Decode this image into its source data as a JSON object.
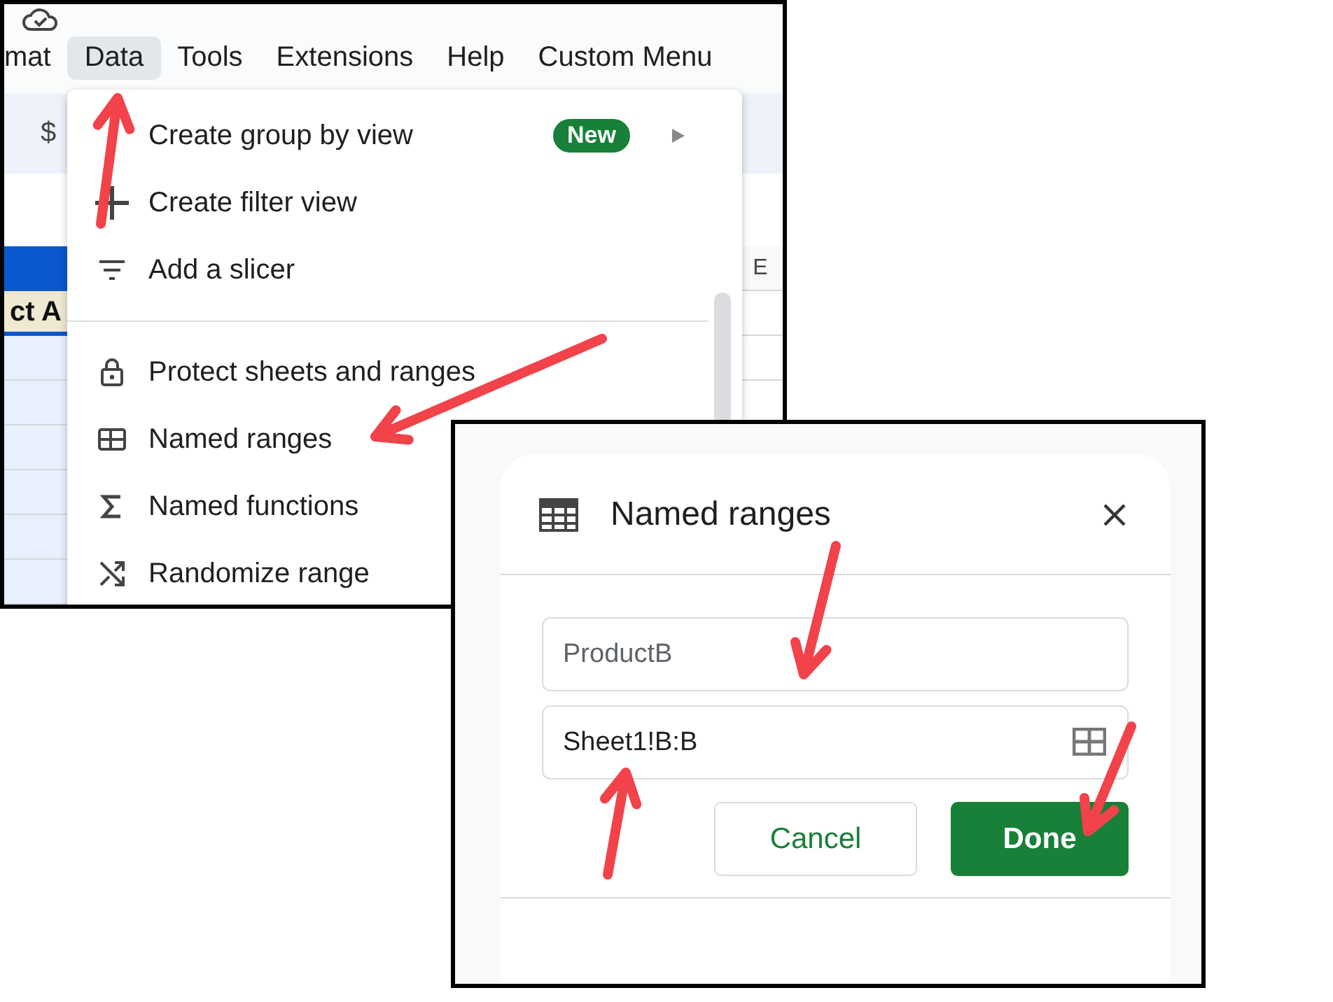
{
  "sheets_window": {
    "menu_bar": [
      {
        "label": "mat",
        "selected": false
      },
      {
        "label": "Data",
        "selected": true
      },
      {
        "label": "Tools",
        "selected": false
      },
      {
        "label": "Extensions",
        "selected": false
      },
      {
        "label": "Help",
        "selected": false
      },
      {
        "label": "Custom Menu",
        "selected": false
      }
    ],
    "toolbar": {
      "currency_button": "$"
    },
    "sheet": {
      "header_cell": "ct A",
      "column_header": "E"
    },
    "data_menu": {
      "sections": [
        {
          "items": [
            {
              "label": "Create group by view",
              "badge": "New",
              "submenu": true
            },
            {
              "label": "Create filter view",
              "submenu": false
            },
            {
              "label": "Add a slicer",
              "submenu": false
            }
          ]
        },
        {
          "items": [
            {
              "label": "Protect sheets and ranges",
              "submenu": false
            },
            {
              "label": "Named ranges",
              "submenu": false
            },
            {
              "label": "Named functions",
              "submenu": false
            },
            {
              "label": "Randomize range",
              "submenu": false
            }
          ]
        }
      ]
    }
  },
  "named_ranges_dialog": {
    "title": "Named ranges",
    "name_field": {
      "value": "ProductB"
    },
    "range_field": {
      "value": "Sheet1!B:B"
    },
    "buttons": [
      {
        "label": "Cancel",
        "kind": "secondary"
      },
      {
        "label": "Done",
        "kind": "primary"
      }
    ]
  }
}
